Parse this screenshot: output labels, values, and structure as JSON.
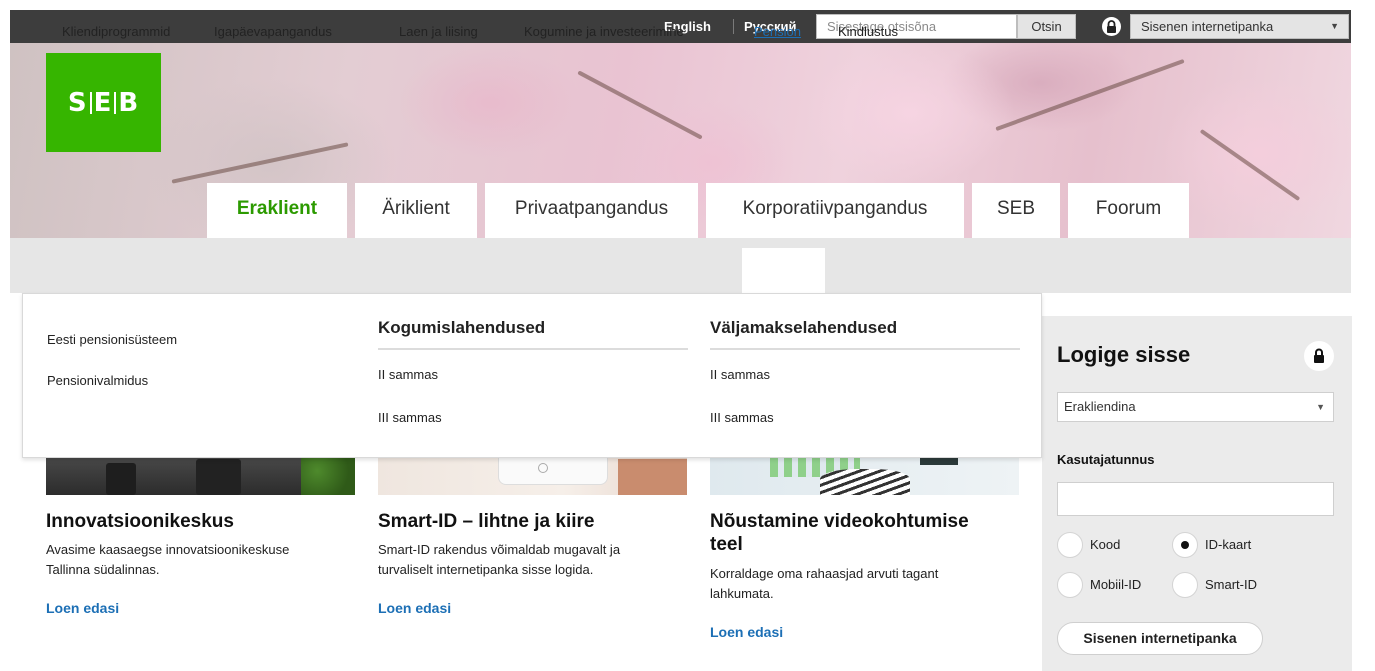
{
  "topbar": {
    "languages": [
      "English",
      "Русский"
    ],
    "search_placeholder": "Sisestage otsisõna",
    "search_button": "Otsin",
    "login_menu": "Sisenen internetipanka"
  },
  "brand": {
    "logo_letters": [
      "S",
      "E",
      "B"
    ],
    "color": "#36b500"
  },
  "main_tabs": [
    {
      "label": "Eraklient",
      "active": true
    },
    {
      "label": "Äriklient"
    },
    {
      "label": "Privaatpangandus"
    },
    {
      "label": "Korporatiivpangandus"
    },
    {
      "label": "SEB"
    },
    {
      "label": "Foorum"
    }
  ],
  "subnav": [
    {
      "label": "Kliendiprogrammid"
    },
    {
      "label": "Igapäevapangandus"
    },
    {
      "label": "Laen ja liising"
    },
    {
      "label": "Kogumine ja investeerimine"
    },
    {
      "label": "Pension",
      "active": true
    },
    {
      "label": "Kindlustus"
    }
  ],
  "dropdown": {
    "col1": [
      "Eesti pensionisüsteem",
      "Pensionivalmidus"
    ],
    "col2": {
      "heading": "Kogumislahendused",
      "items": [
        "II sammas",
        "III sammas"
      ]
    },
    "col3": {
      "heading": "Väljamakselahendused",
      "items": [
        "II sammas",
        "III sammas"
      ]
    }
  },
  "cards": [
    {
      "title": "Innovatsioonikeskus",
      "desc": [
        "Avasime kaasaegse innovatsioonikeskuse",
        "Tallinna südalinnas."
      ],
      "link": "Loen edasi"
    },
    {
      "title": "Smart-ID – lihtne ja kiire",
      "desc": [
        "Smart-ID rakendus võimaldab mugavalt ja",
        "turvaliselt internetipanka sisse logida."
      ],
      "link": "Loen edasi"
    },
    {
      "title": [
        "Nõustamine videokohtumise",
        "teel"
      ],
      "desc": [
        "Korraldage oma rahaasjad arvuti tagant",
        "lahkumata."
      ],
      "link": "Loen edasi"
    }
  ],
  "login": {
    "title": "Logige sisse",
    "type_select": "Erakliendina",
    "username_label": "Kasutajatunnus",
    "username_value": "",
    "methods": [
      {
        "label": "Kood",
        "selected": false
      },
      {
        "label": "ID-kaart",
        "selected": true
      },
      {
        "label": "Mobiil-ID",
        "selected": false
      },
      {
        "label": "Smart-ID",
        "selected": false
      }
    ],
    "submit": "Sisenen internetipanka"
  },
  "icons": {
    "lock": "lock-icon",
    "caret": "chevron-down-icon"
  },
  "colors": {
    "accent_green": "#2c9a00",
    "link_blue": "#1c6fb5",
    "topbar": "#3d3d3d"
  }
}
